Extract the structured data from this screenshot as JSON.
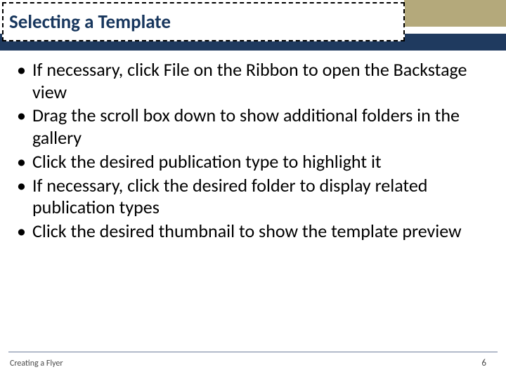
{
  "title": "Selecting a Template",
  "bullets": [
    "If necessary, click File on the Ribbon to open the Backstage view",
    "Drag the scroll box down to show additional folders in the gallery",
    "Click the desired publication type to highlight it",
    "If necessary, click the desired folder to display related publication types",
    "Click the desired thumbnail to show the template preview"
  ],
  "footer": {
    "left": "Creating a Flyer",
    "page": "6"
  }
}
